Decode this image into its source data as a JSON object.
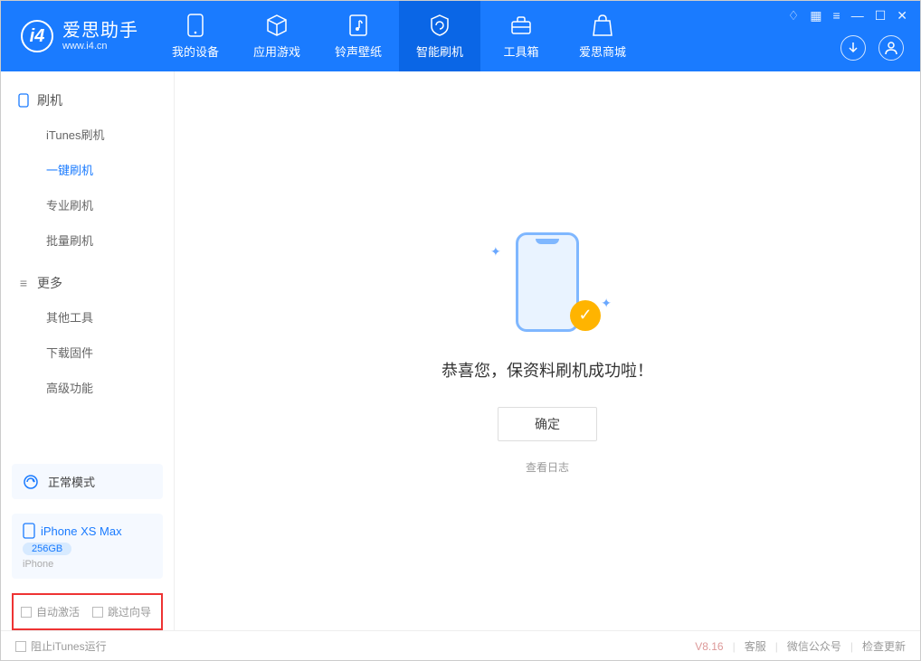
{
  "app": {
    "title": "爱思助手",
    "subtitle": "www.i4.cn"
  },
  "nav": {
    "items": [
      {
        "label": "我的设备"
      },
      {
        "label": "应用游戏"
      },
      {
        "label": "铃声壁纸"
      },
      {
        "label": "智能刷机"
      },
      {
        "label": "工具箱"
      },
      {
        "label": "爱思商城"
      }
    ]
  },
  "sidebar": {
    "section1": "刷机",
    "items1": [
      "iTunes刷机",
      "一键刷机",
      "专业刷机",
      "批量刷机"
    ],
    "section2": "更多",
    "items2": [
      "其他工具",
      "下载固件",
      "高级功能"
    ]
  },
  "mode": {
    "label": "正常模式"
  },
  "device": {
    "name": "iPhone XS Max",
    "storage": "256GB",
    "type": "iPhone"
  },
  "opts": {
    "auto_activate": "自动激活",
    "skip_guide": "跳过向导"
  },
  "main": {
    "success": "恭喜您，保资料刷机成功啦！",
    "ok": "确定",
    "view_log": "查看日志"
  },
  "footer": {
    "block_itunes": "阻止iTunes运行",
    "version": "V8.16",
    "links": [
      "客服",
      "微信公众号",
      "检查更新"
    ]
  }
}
